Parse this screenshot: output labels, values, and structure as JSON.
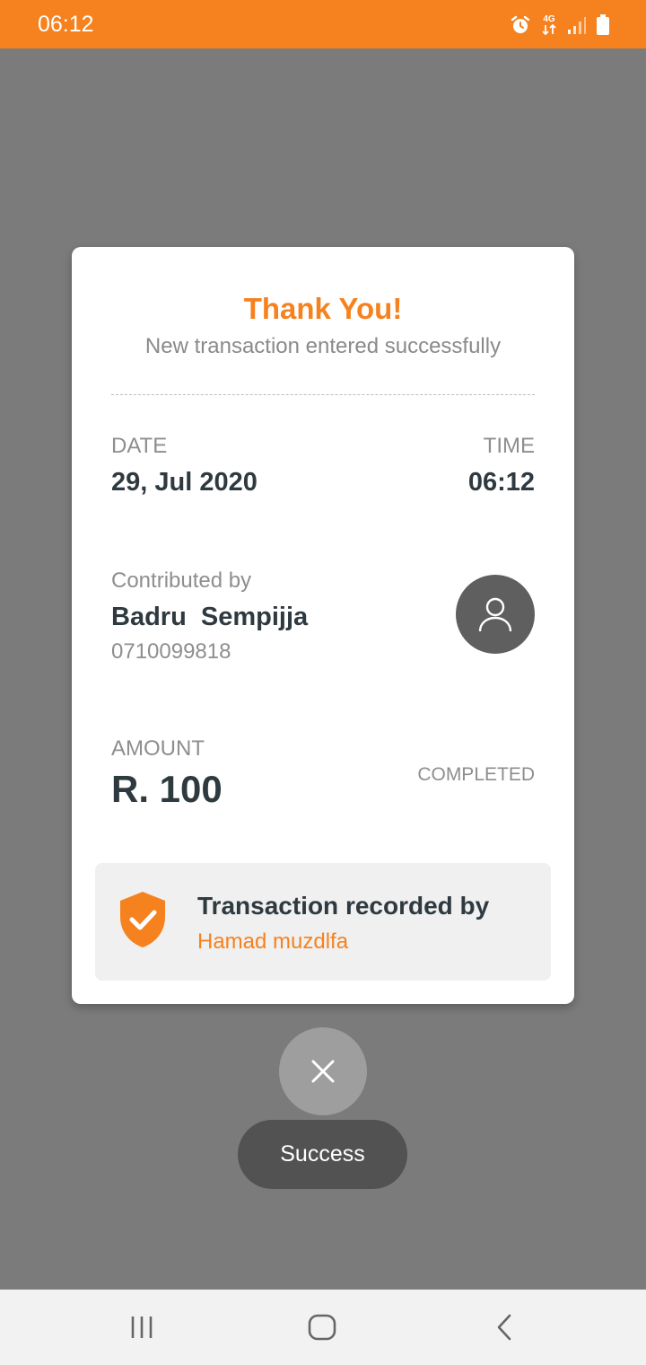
{
  "status_bar": {
    "time": "06:12",
    "network_label": "4G",
    "icons": [
      "alarm-icon",
      "network-4g-icon",
      "signal-icon",
      "battery-icon"
    ],
    "color": "#f5821f"
  },
  "card": {
    "title": "Thank You!",
    "subtitle": "New transaction entered successfully",
    "date_label": "DATE",
    "date_value": "29, Jul 2020",
    "time_label": "TIME",
    "time_value": "06:12",
    "contributed_label": "Contributed by",
    "contributor_name": "Badru  Sempijja",
    "contributor_phone": "0710099818",
    "avatar_icon": "person-icon",
    "amount_label": "AMOUNT",
    "amount_value": "R. 100",
    "status": "COMPLETED",
    "recorded": {
      "icon": "shield-check-icon",
      "title": "Transaction recorded by",
      "name": "Hamad muzdlfa"
    }
  },
  "close_button": {
    "icon": "close-icon"
  },
  "toast": {
    "text": "Success"
  },
  "nav_bar": {
    "icons": [
      "recent-apps-icon",
      "home-icon",
      "back-icon"
    ]
  },
  "colors": {
    "accent": "#f5821f",
    "text_dark": "#2f3a40",
    "text_muted": "#8e8e8e",
    "overlay": "#7b7b7b"
  }
}
